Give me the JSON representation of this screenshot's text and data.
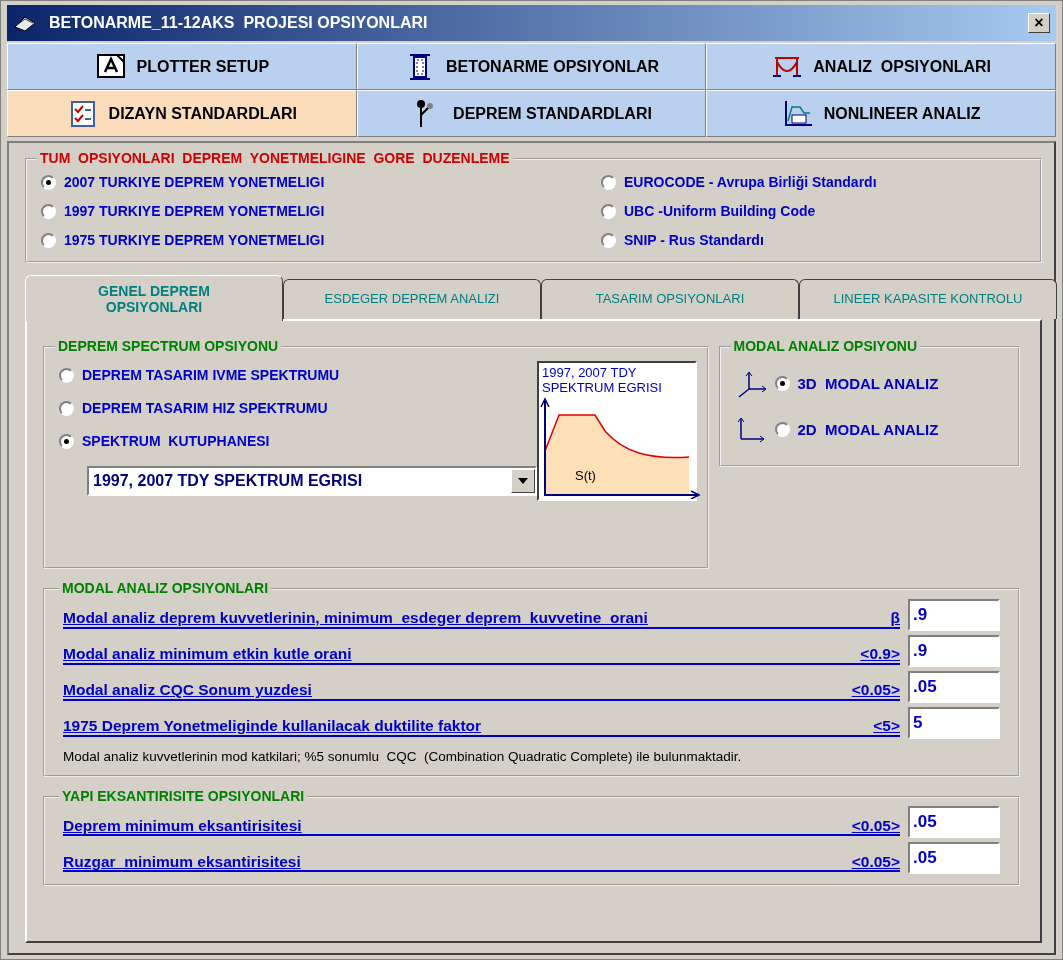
{
  "window": {
    "title": "BETONARME_11-12AKS  PROJESI OPSIYONLARI",
    "close": "×"
  },
  "toolbar": [
    {
      "label": "PLOTTER SETUP",
      "kind": "page",
      "selected": false
    },
    {
      "label": "BETONARME OPSIYONLAR",
      "kind": "column",
      "selected": false
    },
    {
      "label": "ANALIZ  OPSIYONLARI",
      "kind": "frame",
      "selected": false
    },
    {
      "label": "DIZAYN STANDARDLARI",
      "kind": "checklist",
      "selected": true
    },
    {
      "label": "DEPREM STANDARDLARI",
      "kind": "pendulum",
      "selected": false
    },
    {
      "label": "NONLINEER ANALIZ",
      "kind": "curve",
      "selected": false
    }
  ],
  "standards": {
    "title": "TUM  OPSIYONLARI  DEPREM  YONETMELIGINE  GORE  DUZENLEME",
    "options": [
      {
        "label": "2007 TURKIYE DEPREM YONETMELIGI",
        "selected": true
      },
      {
        "label": "1997 TURKIYE DEPREM YONETMELIGI",
        "selected": false
      },
      {
        "label": "1975 TURKIYE DEPREM YONETMELIGI",
        "selected": false
      },
      {
        "label": "EUROCODE - Avrupa Birliği Standardı",
        "selected": false
      },
      {
        "label": "UBC -Uniform Building Code",
        "selected": false
      },
      {
        "label": "SNIP - Rus Standardı",
        "selected": false
      }
    ]
  },
  "tabs": [
    {
      "label": "GENEL DEPREM OPSIYONLARI",
      "selected": true
    },
    {
      "label": "ESDEGER DEPREM ANALIZI",
      "selected": false
    },
    {
      "label": "TASARIM OPSIYONLARI",
      "selected": false
    },
    {
      "label": "LINEER KAPASITE KONTROLU",
      "selected": false
    }
  ],
  "spectrum": {
    "title": "DEPREM SPECTRUM OPSIYONU",
    "options": [
      {
        "label": "DEPREM TASARIM IVME SPEKTRUMU",
        "selected": false
      },
      {
        "label": "DEPREM TASARIM HIZ SPEKTRUMU",
        "selected": false
      },
      {
        "label": "SPEKTRUM  KUTUPHANESI",
        "selected": true
      }
    ],
    "dropdown": {
      "value": "1997, 2007 TDY SPEKTRUM EGRISI"
    },
    "preview": {
      "caption": "1997, 2007 TDY SPEKTRUM EGRISI",
      "axis_label": "S(t)"
    }
  },
  "modal_option": {
    "title": "MODAL ANALIZ OPSIYONU",
    "options": [
      {
        "label": "3D  MODAL ANALIZ",
        "kind": "spatial",
        "selected": true
      },
      {
        "label": "2D  MODAL ANALIZ",
        "kind": "planar",
        "selected": false
      }
    ]
  },
  "modal_params": {
    "title": "MODAL ANALIZ OPSIYONLARI",
    "rows": [
      {
        "label": "Modal analiz deprem kuvvetlerinin, minimum  esdeger deprem  kuvvetine  orani",
        "hint": "β",
        "value": ".9"
      },
      {
        "label": "Modal analiz minimum etkin kutle orani",
        "hint": "<0.9>",
        "value": ".9"
      },
      {
        "label": "Modal analiz CQC Sonum yuzdesi",
        "hint": "<0.05>",
        "value": ".05"
      },
      {
        "label": "1975 Deprem Yonetmeliginde kullanilacak duktilite faktor",
        "hint": "<5>",
        "value": "5"
      }
    ],
    "note": "Modal analiz kuvvetlerinin mod katkilari; %5 sonumlu  CQC  (Combination Quadratic Complete) ile bulunmaktadir."
  },
  "eccentricity": {
    "title": "YAPI EKSANTIRISITE OPSIYONLARI",
    "rows": [
      {
        "label": "Deprem minimum eksantirisitesi",
        "hint": "<0.05>",
        "value": ".05"
      },
      {
        "label": "Ruzgar  minimum eksantirisitesi",
        "hint": "<0.05>",
        "value": ".05"
      }
    ]
  }
}
